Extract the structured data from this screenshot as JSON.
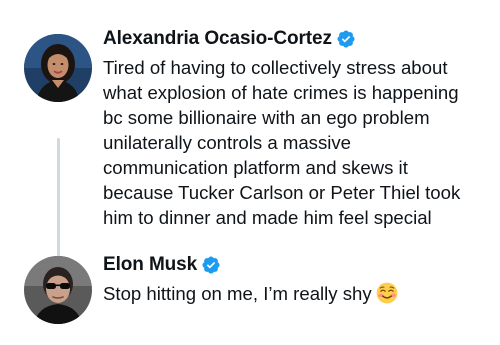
{
  "thread": {
    "tweets": [
      {
        "author": {
          "display_name": "Alexandria Ocasio-Cortez",
          "verified": true
        },
        "text_lines": [
          "Tired of having to collectively stress about",
          "what explosion of hate crimes is happening",
          "bc some billionaire with an ego problem",
          "unilaterally controls a massive",
          "communication platform and skews it",
          "because Tucker Carlson or Peter Thiel took",
          "him to dinner and made him feel special"
        ]
      },
      {
        "author": {
          "display_name": "Elon Musk",
          "verified": true
        },
        "text": "Stop hitting on me, I’m really shy",
        "emoji": "smiling-face-emoji"
      }
    ]
  },
  "colors": {
    "text": "#0f1419",
    "verified_badge": "#1d9bf0",
    "thread_connector": "#cfd9de",
    "background": "#ffffff"
  },
  "icons": {
    "verified": "verified-badge-icon",
    "emoji": "smiling-face-icon"
  }
}
